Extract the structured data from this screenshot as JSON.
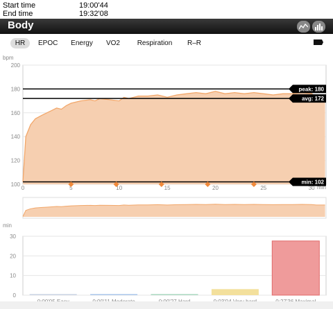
{
  "session": {
    "start_label": "Start time",
    "start_value": "19:00'44",
    "end_label": "End time",
    "end_value": "19:32'08"
  },
  "header": {
    "title": "Body",
    "view_icons": [
      "line-chart-icon",
      "bar-chart-icon"
    ]
  },
  "tabs": [
    {
      "label": "HR",
      "selected": true
    },
    {
      "label": "EPOC",
      "selected": false
    },
    {
      "label": "Energy",
      "selected": false
    },
    {
      "label": "VO2",
      "selected": false
    },
    {
      "label": "Respiration",
      "selected": false
    },
    {
      "label": "R–R",
      "selected": false
    }
  ],
  "colors": {
    "hr_fill": "#f6cfb0",
    "hr_line": "#f2a76a",
    "marker": "#f08a3c",
    "refline": "#000000"
  },
  "chart_data": [
    {
      "type": "area",
      "ylabel": "bpm",
      "xlabel": "min",
      "ylim": [
        100,
        200
      ],
      "xlim": [
        0,
        31.5
      ],
      "yticks": [
        100,
        120,
        140,
        160,
        180,
        200
      ],
      "xticks": [
        0,
        5,
        10,
        15,
        20,
        25,
        30
      ],
      "grid": true,
      "series": [
        {
          "x": [
            0,
            0.3,
            0.8,
            1.3,
            2,
            2.5,
            3,
            3.5,
            4,
            4.5,
            5,
            6,
            7,
            7.5,
            8,
            9,
            10,
            10.5,
            11,
            12,
            13,
            14,
            15,
            16,
            17,
            18,
            19,
            20,
            21,
            22,
            23,
            24,
            25,
            26,
            27,
            28,
            29,
            30,
            30.5,
            31.4
          ],
          "y": [
            102,
            140,
            150,
            155,
            158,
            160,
            162,
            164,
            163,
            166,
            168,
            170,
            171,
            170,
            172,
            171,
            170,
            173,
            172,
            174,
            174,
            175,
            173,
            175,
            176,
            177,
            176,
            178,
            176,
            177,
            176,
            177,
            176,
            175,
            176,
            176,
            177,
            176,
            173,
            173
          ]
        }
      ],
      "reference_lines": [
        {
          "label": "peak: 180",
          "value": 180
        },
        {
          "label": "avg: 172",
          "value": 172
        },
        {
          "label": "min: 102",
          "value": 102
        }
      ],
      "markers_x": [
        5,
        9.7,
        14.4,
        19.2,
        24
      ]
    },
    {
      "type": "bar",
      "ylabel": "min",
      "ylim": [
        0,
        30
      ],
      "yticks": [
        0,
        10,
        20,
        30
      ],
      "grid": true,
      "categories": [
        "0:00'05 Easy",
        "0:00'11 Moderate",
        "0:00'27 Hard",
        "0:03'04 Very hard",
        "0:27'36 Maximal"
      ],
      "values": [
        0.08,
        0.18,
        0.45,
        3.07,
        27.6
      ],
      "colors": [
        "#c9d3e3",
        "#a9c6ea",
        "#a9d8bf",
        "#f3e09c",
        "#ef9b9b"
      ]
    }
  ]
}
